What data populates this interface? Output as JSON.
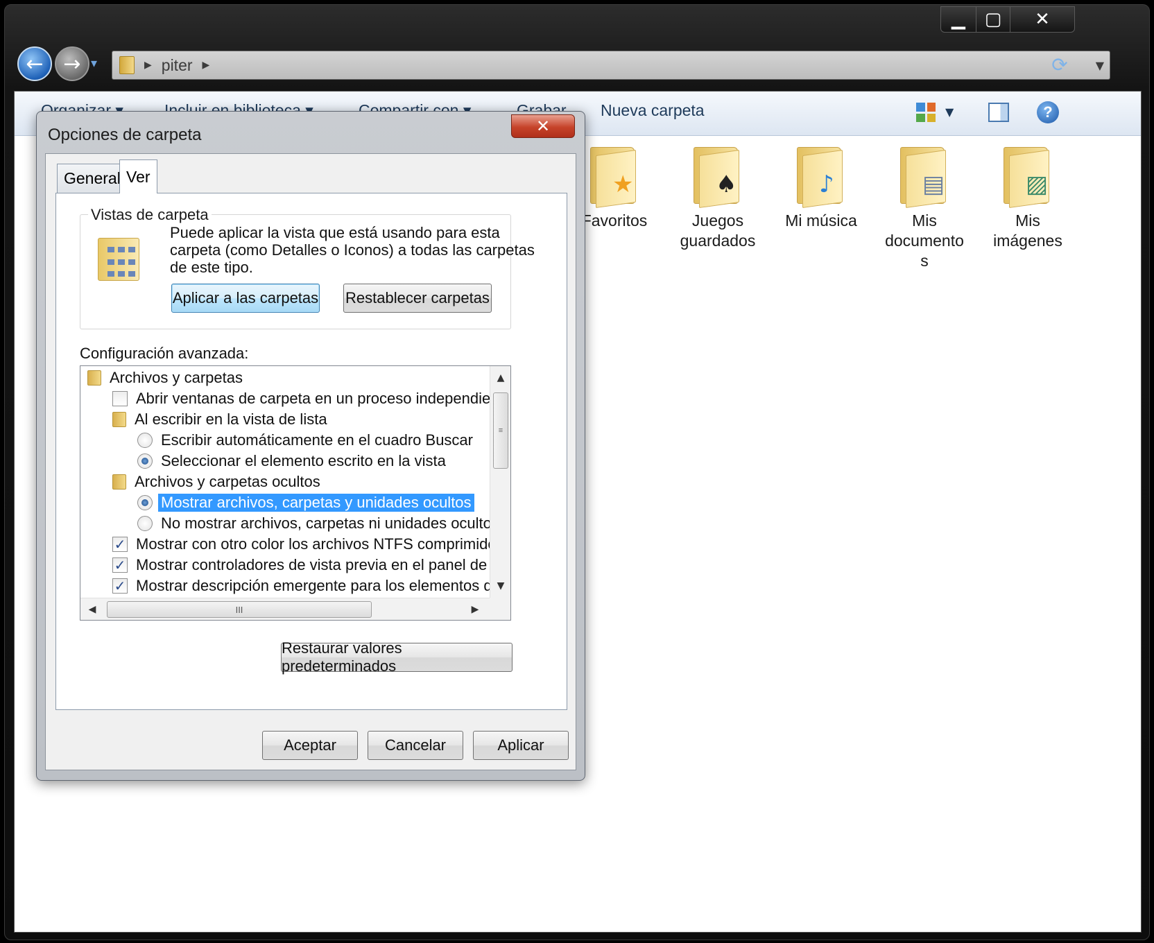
{
  "window": {
    "minimize_glyph": "▁",
    "maximize_glyph": "▢",
    "close_glyph": "✕"
  },
  "nav": {
    "back_glyph": "←",
    "forward_glyph": "→",
    "history_glyph": "▾"
  },
  "address": {
    "segments": [
      "piter"
    ],
    "dropdown_glyph": "▼",
    "refresh_glyph": "⟳"
  },
  "commandbar": {
    "items": [
      "Organizar",
      "Incluir en biblioteca",
      "Compartir con",
      "Grabar",
      "Nueva carpeta"
    ],
    "view_icon": "view-options-icon",
    "preview_pane_icon": "preview-pane-icon",
    "help_glyph": "?"
  },
  "folders": [
    {
      "label": "Favoritos",
      "icon": "favorites-folder-icon",
      "emblem": "★",
      "emblem_color": "#f0a020"
    },
    {
      "label": "Juegos guardados",
      "icon": "saved-games-folder-icon",
      "emblem": "♠",
      "emblem_color": "#222222"
    },
    {
      "label": "Mi música",
      "icon": "music-folder-icon",
      "emblem": "♪",
      "emblem_color": "#2b7fd4"
    },
    {
      "label": "Mis documentos",
      "icon": "documents-folder-icon",
      "emblem": "▤",
      "emblem_color": "#6a7fa0"
    },
    {
      "label": "Mis imágenes",
      "icon": "pictures-folder-icon",
      "emblem": "▨",
      "emblem_color": "#3a8a6a"
    }
  ],
  "dialog": {
    "title": "Opciones de carpeta",
    "close_glyph": "✕",
    "tabs": [
      "General",
      "Ver"
    ],
    "active_tab": "Ver",
    "folder_views": {
      "legend": "Vistas de carpeta",
      "description_lines": [
        "Puede aplicar la vista que está usando para esta",
        "carpeta (como Detalles o Iconos) a todas las carpetas",
        "de este tipo."
      ],
      "apply_button": "Aplicar a las carpetas",
      "reset_button": "Restablecer carpetas"
    },
    "advanced_label": "Configuración avanzada:",
    "tree": [
      {
        "type": "folder",
        "indent": 0,
        "label": "Archivos y carpetas"
      },
      {
        "type": "checkbox",
        "indent": 1,
        "checked": false,
        "label": "Abrir ventanas de carpeta  en un proceso independiente"
      },
      {
        "type": "folder",
        "indent": 1,
        "label": "Al escribir en la vista de lista"
      },
      {
        "type": "radio",
        "indent": 2,
        "checked": false,
        "label": "Escribir automáticamente en el cuadro Buscar"
      },
      {
        "type": "radio",
        "indent": 2,
        "checked": true,
        "label": "Seleccionar el elemento escrito en la vista"
      },
      {
        "type": "folder",
        "indent": 1,
        "label": "Archivos y carpetas ocultos"
      },
      {
        "type": "radio",
        "indent": 2,
        "checked": true,
        "selected": true,
        "label": "Mostrar archivos, carpetas y unidades ocultos"
      },
      {
        "type": "radio",
        "indent": 2,
        "checked": false,
        "label": "No mostrar archivos, carpetas ni unidades ocultos"
      },
      {
        "type": "checkbox",
        "indent": 1,
        "checked": true,
        "label": "Mostrar con otro color los archivos NTFS comprimidos o c"
      },
      {
        "type": "checkbox",
        "indent": 1,
        "checked": true,
        "label": "Mostrar controladores de vista previa en el panel de vista"
      },
      {
        "type": "checkbox",
        "indent": 1,
        "checked": true,
        "label": "Mostrar descripción emergente para los elementos de car"
      }
    ],
    "restore_button": "Restaurar valores predeterminados",
    "ok_button": "Aceptar",
    "cancel_button": "Cancelar",
    "apply_button": "Aplicar",
    "scroll_up_glyph": "▲",
    "scroll_down_glyph": "▼",
    "scroll_left_glyph": "◀",
    "scroll_right_glyph": "▶",
    "scroll_grip_glyph": "III",
    "check_glyph": "✓"
  }
}
